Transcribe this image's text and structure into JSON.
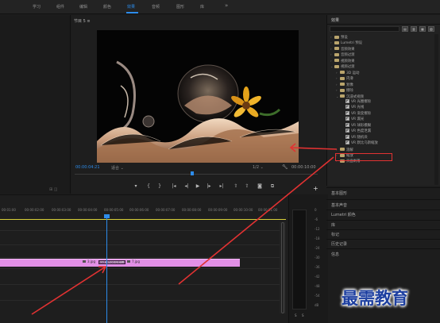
{
  "menu": {
    "items": [
      "学习",
      "组件",
      "编辑",
      "颜色",
      "效果",
      "音频",
      "图形",
      "库"
    ],
    "active": "效果",
    "more": "»"
  },
  "program": {
    "title": "节目 5 ≡",
    "timecode_current": "00:00:04:21",
    "fit": "适合",
    "resolution": "1/2",
    "timecode_duration": "00:00:10:00"
  },
  "timeline": {
    "ruler_labels": [
      "00:01:00",
      "00:00:02:00",
      "00:00:03:00",
      "00:00:04:00",
      "00:00:05:00",
      "00:00:06:00",
      "00:00:07:00",
      "00:00:08:00",
      "00:00:09:00",
      "00:00:10:00",
      "00:00:11:00"
    ],
    "clip_a": "3.jpg",
    "transition": "VR 数位化色彩溶解",
    "clip_b": "7.jpg"
  },
  "meters": {
    "values": [
      "0",
      "-6",
      "-12",
      "-18",
      "-24",
      "-30",
      "-36",
      "-42",
      "-48",
      "-54",
      "dB"
    ],
    "solo": [
      "S",
      "S"
    ]
  },
  "effects": {
    "title": "效果",
    "tree": [
      {
        "label": "预设",
        "level": 0,
        "icon": "folder",
        "arrow": "›"
      },
      {
        "label": "Lumetri 预设",
        "level": 0,
        "icon": "folder",
        "arrow": "›"
      },
      {
        "label": "音频效果",
        "level": 0,
        "icon": "folder",
        "arrow": "›"
      },
      {
        "label": "音频过渡",
        "level": 0,
        "icon": "folder",
        "arrow": "›"
      },
      {
        "label": "视频效果",
        "level": 0,
        "icon": "folder",
        "arrow": "›"
      },
      {
        "label": "视频过渡",
        "level": 0,
        "icon": "folder",
        "arrow": "⌄"
      },
      {
        "label": "3D 运动",
        "level": 1,
        "icon": "folder",
        "arrow": "›"
      },
      {
        "label": "内滑",
        "level": 1,
        "icon": "folder",
        "arrow": "›"
      },
      {
        "label": "划像",
        "level": 1,
        "icon": "folder",
        "arrow": "›"
      },
      {
        "label": "擦除",
        "level": 1,
        "icon": "folder",
        "arrow": "›"
      },
      {
        "label": "沉浸式视频",
        "level": 1,
        "icon": "folder",
        "arrow": "⌄"
      },
      {
        "label": "VR 光圈擦除",
        "level": 2,
        "icon": "fx",
        "arrow": ""
      },
      {
        "label": "VR 光线",
        "level": 2,
        "icon": "fx",
        "arrow": ""
      },
      {
        "label": "VR 渐变擦除",
        "level": 2,
        "icon": "fx",
        "arrow": ""
      },
      {
        "label": "VR 漏光",
        "level": 2,
        "icon": "fx",
        "arrow": ""
      },
      {
        "label": "VR 球形模糊",
        "level": 2,
        "icon": "fx",
        "arrow": ""
      },
      {
        "label": "VR 色度泄漏",
        "level": 2,
        "icon": "fx",
        "arrow": ""
      },
      {
        "label": "VR 随机块",
        "level": 2,
        "icon": "fx",
        "arrow": ""
      },
      {
        "label": "VR 默比乌斯缩放",
        "level": 2,
        "icon": "fx",
        "arrow": ""
      },
      {
        "label": "溶解",
        "level": 1,
        "icon": "folder",
        "arrow": "›"
      },
      {
        "label": "缩放",
        "level": 1,
        "icon": "folder",
        "arrow": "›"
      },
      {
        "label": "页面剥落",
        "level": 1,
        "icon": "folder",
        "arrow": "›"
      }
    ]
  },
  "side_panels": [
    "基本图形",
    "基本声音",
    "Lumetri 颜色",
    "库",
    "标记",
    "历史记录",
    "信息"
  ],
  "watermark": "最需教育",
  "colors": {
    "accent": "#2d8ceb",
    "clip": "#e290e6",
    "highlight": "#e13232",
    "arrow": "#e13232"
  }
}
